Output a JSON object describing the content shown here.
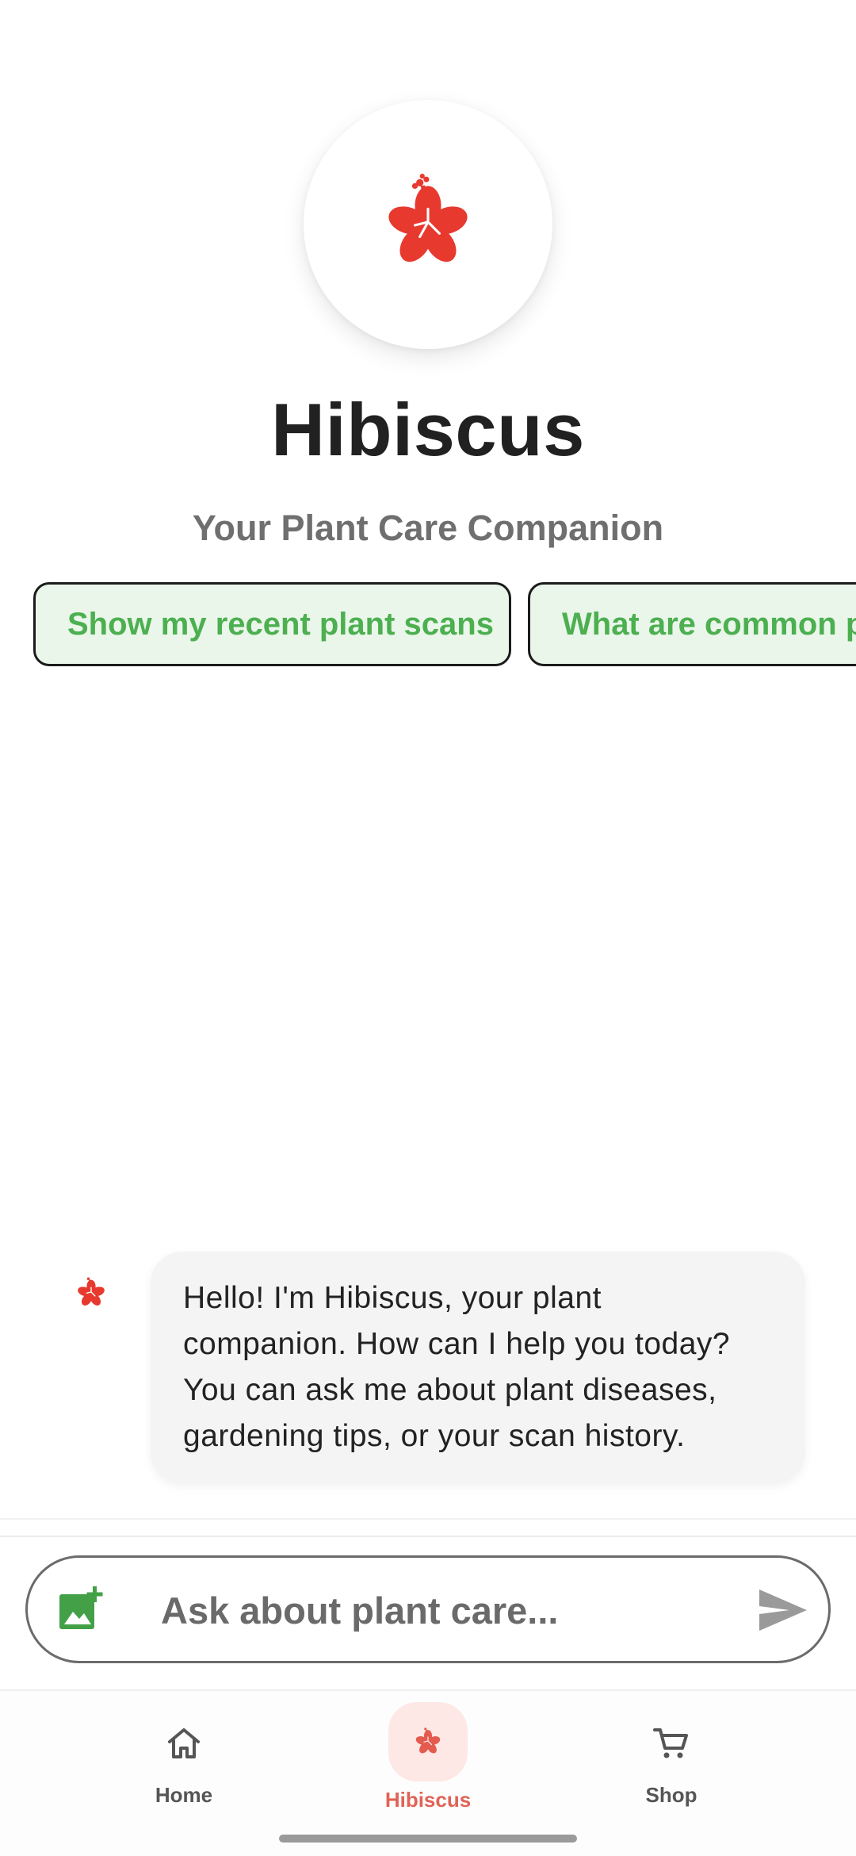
{
  "header": {
    "logo_icon": "hibiscus-flower-icon",
    "title": "Hibiscus",
    "subtitle": "Your Plant Care Companion"
  },
  "suggestions": [
    {
      "label": "Show my recent plant scans"
    },
    {
      "label": "What are common p"
    }
  ],
  "chat": {
    "messages": [
      {
        "sender": "bot",
        "avatar_icon": "hibiscus-flower-icon",
        "text": "Hello! I'm Hibiscus, your plant companion. How can I help you today? You can ask me about plant diseases, gardening tips, or your scan history."
      }
    ]
  },
  "composer": {
    "attach_icon": "add-photo-icon",
    "placeholder": "Ask about plant care...",
    "value": "",
    "send_icon": "send-icon"
  },
  "bottom_nav": {
    "items": [
      {
        "label": "Home",
        "icon": "home-icon",
        "active": false
      },
      {
        "label": "Hibiscus",
        "icon": "hibiscus-flower-icon",
        "active": true
      },
      {
        "label": "Shop",
        "icon": "cart-icon",
        "active": false
      }
    ]
  },
  "colors": {
    "brand_red": "#e8392f",
    "accent_green": "#4caf50",
    "chip_background": "#eaf6ea",
    "active_nav_pill": "#fde8e6",
    "active_nav_label": "#e06356"
  }
}
